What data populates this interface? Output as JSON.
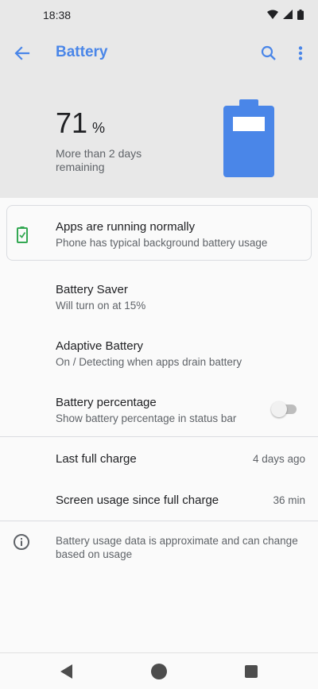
{
  "status_bar": {
    "time": "18:38"
  },
  "app_bar": {
    "title": "Battery"
  },
  "header": {
    "percent": "71",
    "percent_unit": "%",
    "remaining": "More than 2 days remaining",
    "level": 0.71
  },
  "tip": {
    "title": "Apps are running normally",
    "subtitle": "Phone has typical background battery usage"
  },
  "settings": [
    {
      "title": "Battery Saver",
      "subtitle": "Will turn on at 15%"
    },
    {
      "title": "Adaptive Battery",
      "subtitle": "On / Detecting when apps drain battery"
    },
    {
      "title": "Battery percentage",
      "subtitle": "Show battery percentage in status bar",
      "toggle_on": false
    }
  ],
  "stats": [
    {
      "label": "Last full charge",
      "value": "4 days ago"
    },
    {
      "label": "Screen usage since full charge",
      "value": "36 min"
    }
  ],
  "footer_note": "Battery usage data is approximate and can change based on usage",
  "colors": {
    "accent": "#4a86e8",
    "battery_fill": "#4a86e8",
    "tip_icon": "#34a853",
    "header_bg": "#e8e8e8"
  },
  "icons": {
    "back": "arrow-left-icon",
    "search": "search-icon",
    "more": "more-vert-icon",
    "tip": "battery-ok-icon",
    "info": "info-icon",
    "nav_back": "nav-back-icon",
    "nav_home": "nav-home-icon",
    "nav_recents": "nav-recents-icon"
  }
}
